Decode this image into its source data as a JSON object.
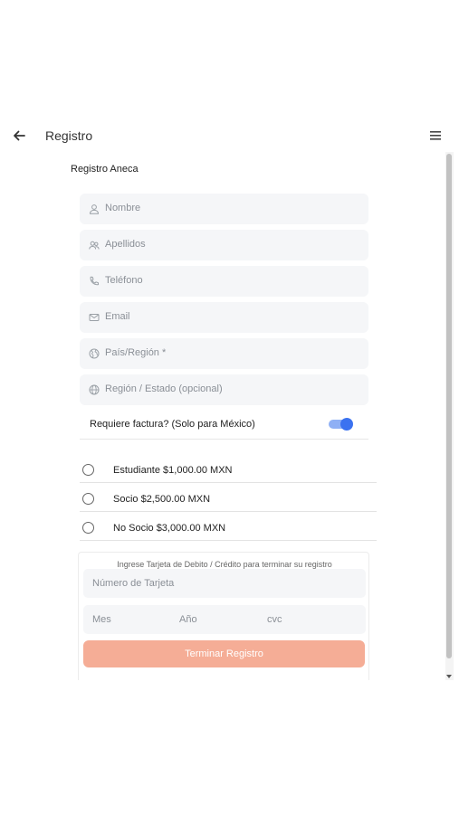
{
  "header": {
    "title": "Registro"
  },
  "form": {
    "subtitle": "Registro Aneca",
    "fields": [
      {
        "placeholder": "Nombre",
        "icon": "user-icon"
      },
      {
        "placeholder": "Apellidos",
        "icon": "users-icon"
      },
      {
        "placeholder": "Teléfono",
        "icon": "phone-icon"
      },
      {
        "placeholder": "Email",
        "icon": "mail-icon"
      },
      {
        "placeholder": "País/Región *",
        "icon": "globe-americas-icon"
      },
      {
        "placeholder": "Región / Estado (opcional)",
        "icon": "globe-icon"
      }
    ],
    "invoice_toggle": {
      "label": "Requiere factura? (Solo para México)",
      "enabled": true
    },
    "options": [
      {
        "label": "Estudiante $1,000.00 MXN",
        "selected": false
      },
      {
        "label": "Socio $2,500.00 MXN",
        "selected": false
      },
      {
        "label": "No Socio $3,000.00 MXN",
        "selected": false
      }
    ]
  },
  "payment": {
    "caption": "Ingrese Tarjeta de Debito / Crédito para terminar su registro",
    "card_number_placeholder": "Número de Tarjeta",
    "month_placeholder": "Mes",
    "year_placeholder": "Año",
    "cvc_placeholder": "cvc",
    "submit_label": "Terminar Registro"
  },
  "colors": {
    "accent": "#3b72f0",
    "submit": "#f5ad96",
    "field_bg": "#f5f6f8"
  }
}
